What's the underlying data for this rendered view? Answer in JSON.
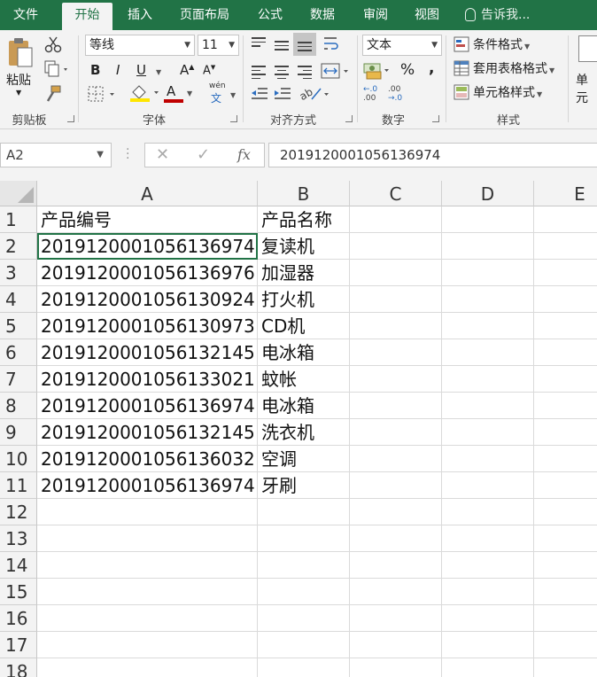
{
  "tabs": [
    {
      "label": "文件",
      "active": false
    },
    {
      "label": "开始",
      "active": true
    },
    {
      "label": "插入",
      "active": false
    },
    {
      "label": "页面布局",
      "active": false
    },
    {
      "label": "公式",
      "active": false
    },
    {
      "label": "数据",
      "active": false
    },
    {
      "label": "审阅",
      "active": false
    },
    {
      "label": "视图",
      "active": false
    }
  ],
  "tell_me": "告诉我...",
  "ribbon": {
    "paste_label": "粘贴",
    "font_name": "等线",
    "font_size": "11",
    "bold": "B",
    "italic": "I",
    "underline": "U",
    "grow_font": "A",
    "shrink_font": "A",
    "font_color": "A",
    "phonetic_top": "wén",
    "phonetic_bottom": "文",
    "number_format": "文本",
    "percent": "%",
    "comma": ",",
    "inc_decimal_top": "←.0",
    "inc_decimal_bottom": ".00",
    "dec_decimal_top": ".00",
    "dec_decimal_bottom": "→.0",
    "cond_format": "条件格式",
    "table_format": "套用表格格式",
    "cell_styles": "单元格样式",
    "cells_cut": "单元",
    "groups": {
      "clipboard": "剪贴板",
      "font": "字体",
      "alignment": "对齐方式",
      "number": "数字",
      "styles": "样式"
    }
  },
  "formula_bar": {
    "name_box": "A2",
    "formula": "201912000105613697​4",
    "fx": "fx"
  },
  "sheet": {
    "columns": [
      "A",
      "B",
      "C",
      "D",
      "E"
    ],
    "row_numbers": [
      "1",
      "2",
      "3",
      "4",
      "5",
      "6",
      "7",
      "8",
      "9",
      "10",
      "11",
      "12",
      "13",
      "14",
      "15",
      "16",
      "17",
      "18"
    ],
    "rows": [
      [
        "产品编号",
        "产品名称"
      ],
      [
        "2019120001056136974",
        "复读机"
      ],
      [
        "2019120001056136976",
        "加湿器"
      ],
      [
        "2019120001056130924",
        "打火机"
      ],
      [
        "2019120001056130973",
        "CD机"
      ],
      [
        "2019120001056132145",
        "电冰箱"
      ],
      [
        "2019120001056133021",
        "蚊帐"
      ],
      [
        "2019120001056136974",
        "电冰箱"
      ],
      [
        "2019120001056132145",
        "洗衣机"
      ],
      [
        "2019120001056136032",
        "空调"
      ],
      [
        "2019120001056136974",
        "牙刷"
      ]
    ]
  }
}
